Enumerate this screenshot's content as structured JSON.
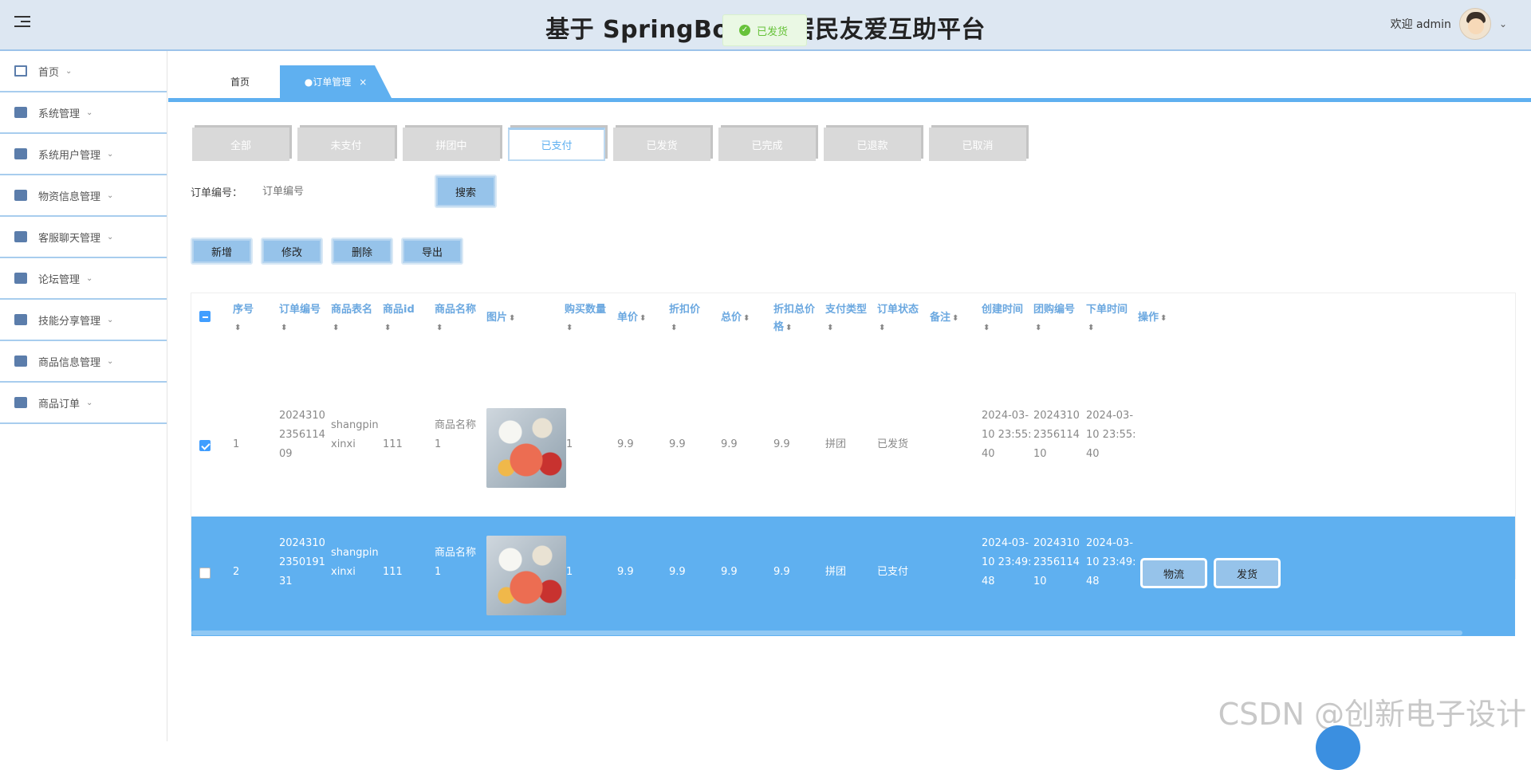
{
  "header": {
    "title": "基于 SpringBoot 的居民友爱互助平台",
    "toast": "已发货",
    "welcome": "欢迎 admin"
  },
  "sidebar": {
    "items": [
      {
        "label": "首页"
      },
      {
        "label": "系统管理"
      },
      {
        "label": "系统用户管理"
      },
      {
        "label": "物资信息管理"
      },
      {
        "label": "客服聊天管理"
      },
      {
        "label": "论坛管理"
      },
      {
        "label": "技能分享管理"
      },
      {
        "label": "商品信息管理"
      },
      {
        "label": "商品订单"
      }
    ]
  },
  "tabs": {
    "home": "首页",
    "active": "●订单管理",
    "close": "×"
  },
  "status_tabs": [
    "全部",
    "未支付",
    "拼团中",
    "已支付",
    "已发货",
    "已完成",
    "已退款",
    "已取消"
  ],
  "status_active_index": 3,
  "search": {
    "label": "订单编号：",
    "placeholder": "订单编号",
    "button": "搜索"
  },
  "actions": {
    "add": "新增",
    "edit": "修改",
    "delete": "删除",
    "export": "导出"
  },
  "table": {
    "headers": [
      "序号",
      "订单编号",
      "商品表名",
      "商品id",
      "商品名称",
      "图片",
      "购买数量",
      "单价",
      "折扣价",
      "总价",
      "折扣总价格",
      "支付类型",
      "订单状态",
      "备注",
      "创建时间",
      "团购编号",
      "下单时间",
      "操作"
    ],
    "rows": [
      {
        "checked": true,
        "index": "1",
        "order_no": [
          "2024310",
          "2356114",
          "09"
        ],
        "table_name": [
          "shangpin",
          "xinxi"
        ],
        "product_id": "111",
        "product_name": [
          "商品名称",
          "1"
        ],
        "qty": "1",
        "price": "9.9",
        "discount_price": "9.9",
        "total": "9.9",
        "discount_total": "9.9",
        "pay_type": "拼团",
        "status": "已发货",
        "remark": "",
        "created": [
          "2024-03-",
          "10 23:55:",
          "40"
        ],
        "group_no": [
          "2024310",
          "2356114",
          "10"
        ],
        "order_time": [
          "2024-03-",
          "10 23:55:",
          "40"
        ]
      },
      {
        "checked": false,
        "index": "2",
        "order_no": [
          "2024310",
          "2350191",
          "31"
        ],
        "table_name": [
          "shangpin",
          "xinxi"
        ],
        "product_id": "111",
        "product_name": [
          "商品名称",
          "1"
        ],
        "qty": "1",
        "price": "9.9",
        "discount_price": "9.9",
        "total": "9.9",
        "discount_total": "9.9",
        "pay_type": "拼团",
        "status": "已支付",
        "remark": "",
        "created": [
          "2024-03-",
          "10 23:49:",
          "48"
        ],
        "group_no": [
          "2024310",
          "2356114",
          "10"
        ],
        "order_time": [
          "2024-03-",
          "10 23:49:",
          "48"
        ],
        "ops": [
          "物流",
          "发货"
        ]
      }
    ]
  },
  "watermark": "CSDN @创新电子设计"
}
